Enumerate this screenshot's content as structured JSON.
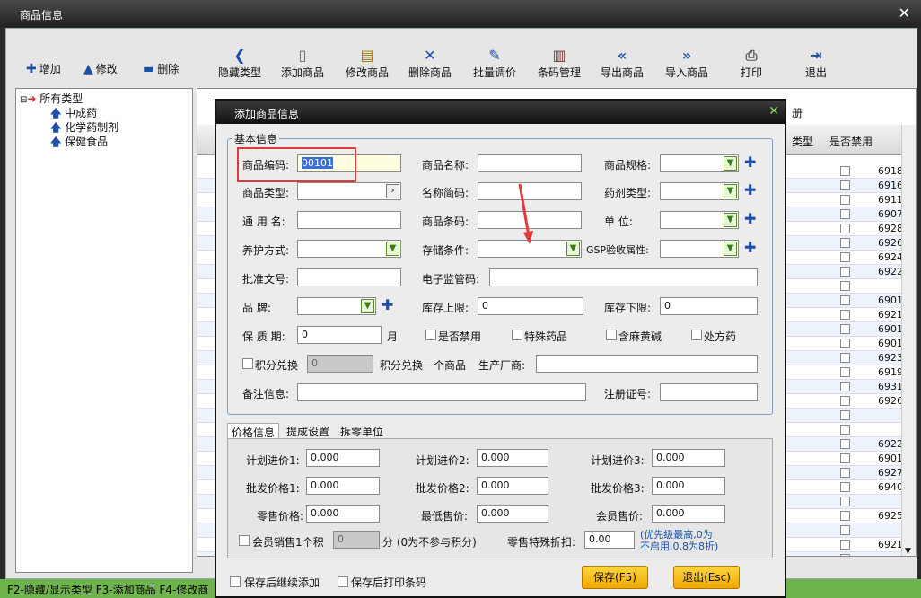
{
  "window": {
    "title": "商品信息"
  },
  "toolbar": {
    "hide_type": "隐藏类型",
    "add_goods": "添加商品",
    "edit_goods": "修改商品",
    "delete_goods": "删除商品",
    "batch_price": "批量调价",
    "barcode": "条码管理",
    "export": "导出商品",
    "import": "导入商品",
    "print": "打印",
    "exit": "退出"
  },
  "type_actions": {
    "add": "增加",
    "edit": "修改",
    "delete": "删除"
  },
  "tree": {
    "root": "所有类型",
    "items": [
      "中成药",
      "化学药制剂",
      "保健食品"
    ]
  },
  "grid": {
    "col_type": "类型",
    "col_disabled": "是否禁用",
    "col_extra": "册",
    "codes": [
      "6918",
      "6916",
      "6911",
      "6907",
      "6928",
      "6926",
      "6924",
      "6922",
      "",
      "6901",
      "6921",
      "6901",
      "6901",
      "6923",
      "6919",
      "6931",
      "6926",
      "",
      "",
      "6922",
      "6901",
      "6927",
      "6940",
      "",
      "6925",
      "",
      "6921",
      ""
    ]
  },
  "status": {
    "text": "F2-隐藏/显示类型  F3-添加商品 F4-修改商"
  },
  "dialog": {
    "title": "添加商品信息",
    "basic_info": "基本信息",
    "f": {
      "code": "商品编码:",
      "name": "商品名称:",
      "spec": "商品规格:",
      "type": "商品类型:",
      "short": "名称简码:",
      "drug_type": "药剂类型:",
      "common": "通 用 名:",
      "barcode": "商品条码:",
      "unit": "单    位:",
      "care": "养护方式:",
      "storage": "存储条件:",
      "gsp": "GSP验收属性:",
      "approval": "批准文号:",
      "supervise": "电子监管码:",
      "brand": "品    牌:",
      "stock_max": "库存上限:",
      "stock_min": "库存下限:",
      "shelf": "保 质 期:",
      "month": "月",
      "disabled": "是否禁用",
      "special": "特殊药品",
      "ephedrine": "含麻黄碱",
      "rx": "处方药",
      "points_exchange": "积分兑换",
      "exchange_one": "积分兑换一个商品",
      "maker": "生产厂商:",
      "remark": "备注信息:",
      "reg": "注册证号:"
    },
    "v": {
      "code": "00101",
      "stock_max": "0",
      "stock_min": "0",
      "shelf": "0",
      "points": "0"
    },
    "tabs": [
      "价格信息",
      "提成设置",
      "拆零单位"
    ],
    "p": {
      "plan1": "计划进价1:",
      "plan2": "计划进价2:",
      "plan3": "计划进价3:",
      "whole1": "批发价格1:",
      "whole2": "批发价格2:",
      "whole3": "批发价格3:",
      "retail": "零售价格:",
      "min": "最低售价:",
      "member": "会员售价:",
      "member_points": "会员销售1个积",
      "points_note": "分 (0为不参与积分)",
      "discount": "零售特殊折扣:",
      "note1": "(优先级最高,0为",
      "note2": "不启用,0.8为8折)"
    },
    "pv": {
      "plan1": "0.000",
      "plan2": "0.000",
      "plan3": "0.000",
      "whole1": "0.000",
      "whole2": "0.000",
      "whole3": "0.000",
      "retail": "0.000",
      "min": "0.000",
      "member": "0.000",
      "points": "0",
      "discount": "0.00"
    },
    "bottom": {
      "keep_add": "保存后继续添加",
      "print_barcode": "保存后打印条码",
      "save": "保存(F5)",
      "exit": "退出(Esc)"
    }
  }
}
